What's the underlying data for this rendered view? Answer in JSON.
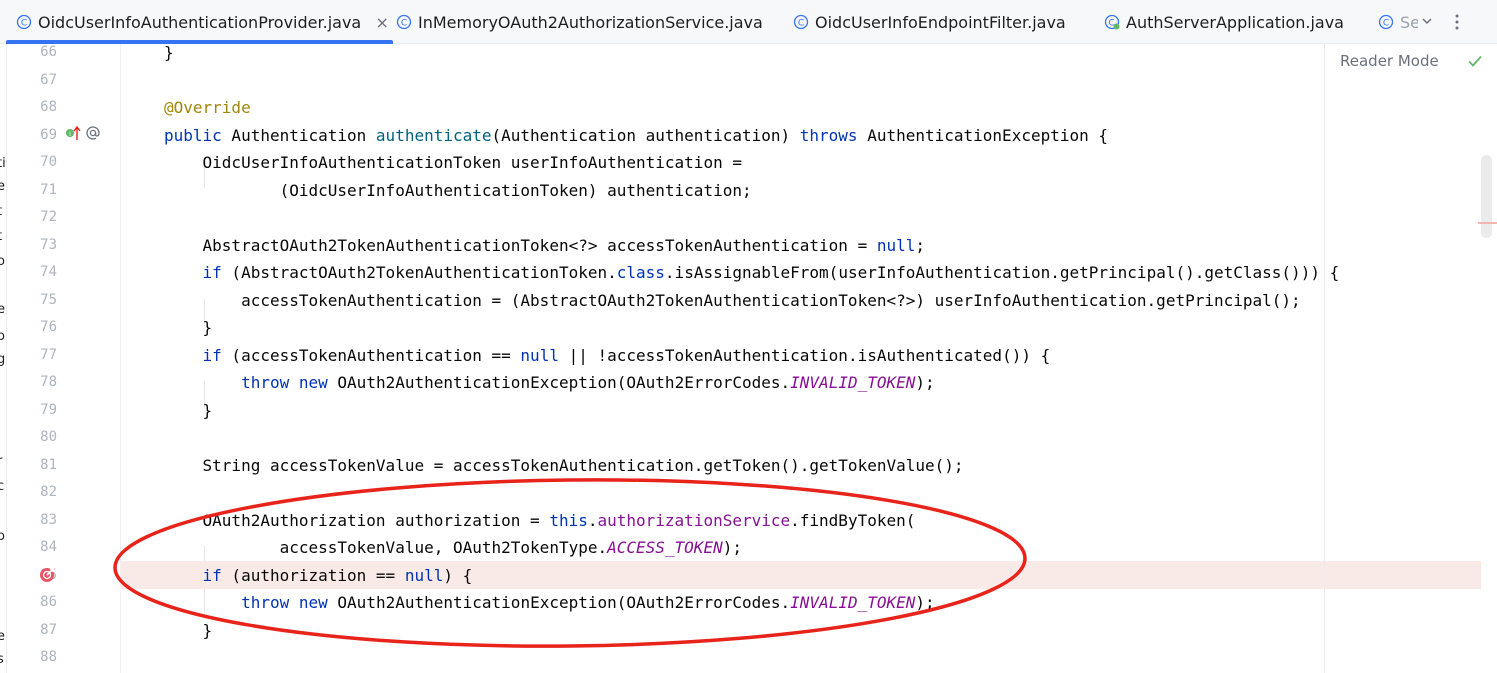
{
  "tabs": [
    {
      "label": "OidcUserInfoAuthenticationProvider.java",
      "icon": "class-icon",
      "active": true,
      "close": "×"
    },
    {
      "label": "InMemoryOAuth2AuthorizationService.java",
      "icon": "class-icon"
    },
    {
      "label": "OidcUserInfoEndpointFilter.java",
      "icon": "class-icon"
    },
    {
      "label": "AuthServerApplication.java",
      "icon": "spring-class-icon"
    },
    {
      "label": "Se",
      "icon": "class-icon"
    }
  ],
  "tab_overflow": {
    "icon": "chevron-down-icon",
    "more_icon": "more-vertical-icon"
  },
  "editor": {
    "reader_mode": "Reader Mode",
    "status_icon": "check-icon",
    "line_numbers": [
      "66",
      "67",
      "68",
      "69",
      "70",
      "71",
      "72",
      "73",
      "74",
      "75",
      "76",
      "77",
      "78",
      "79",
      "80",
      "81",
      "82",
      "83",
      "84",
      "85",
      "86",
      "87",
      "88"
    ],
    "gutter_icons": {
      "line69": [
        "implement-icon",
        "at-sign-icon"
      ],
      "line85": "breakpoint-icon"
    },
    "highlighted_line": 85
  },
  "code_lines": [
    {
      "ln": "66",
      "text": "}"
    },
    {
      "ln": "67",
      "text": ""
    },
    {
      "ln": "68",
      "text": "@Override"
    },
    {
      "ln": "69",
      "text": "public Authentication authenticate(Authentication authentication) throws AuthenticationException {"
    },
    {
      "ln": "70",
      "text": "    OidcUserInfoAuthenticationToken userInfoAuthentication ="
    },
    {
      "ln": "71",
      "text": "            (OidcUserInfoAuthenticationToken) authentication;"
    },
    {
      "ln": "72",
      "text": ""
    },
    {
      "ln": "73",
      "text": "    AbstractOAuth2TokenAuthenticationToken<?> accessTokenAuthentication = null;"
    },
    {
      "ln": "74",
      "text": "    if (AbstractOAuth2TokenAuthenticationToken.class.isAssignableFrom(userInfoAuthentication.getPrincipal().getClass())) {"
    },
    {
      "ln": "75",
      "text": "        accessTokenAuthentication = (AbstractOAuth2TokenAuthenticationToken<?>) userInfoAuthentication.getPrincipal();"
    },
    {
      "ln": "76",
      "text": "    }"
    },
    {
      "ln": "77",
      "text": "    if (accessTokenAuthentication == null || !accessTokenAuthentication.isAuthenticated()) {"
    },
    {
      "ln": "78",
      "text": "        throw new OAuth2AuthenticationException(OAuth2ErrorCodes.INVALID_TOKEN);"
    },
    {
      "ln": "79",
      "text": "    }"
    },
    {
      "ln": "80",
      "text": ""
    },
    {
      "ln": "81",
      "text": "    String accessTokenValue = accessTokenAuthentication.getToken().getTokenValue();"
    },
    {
      "ln": "82",
      "text": ""
    },
    {
      "ln": "83",
      "text": "    OAuth2Authorization authorization = this.authorizationService.findByToken("
    },
    {
      "ln": "84",
      "text": "            accessTokenValue, OAuth2TokenType.ACCESS_TOKEN);"
    },
    {
      "ln": "85",
      "text": "    if (authorization == null) {"
    },
    {
      "ln": "86",
      "text": "        throw new OAuth2AuthenticationException(OAuth2ErrorCodes.INVALID_TOKEN);"
    },
    {
      "ln": "87",
      "text": "    }"
    },
    {
      "ln": "88",
      "text": ""
    }
  ],
  "colors": {
    "keyword": "#0033b3",
    "annotation": "#9e880d",
    "method": "#00627a",
    "field": "#871094",
    "highlight_line": "#faeae7",
    "tab_underline": "#3574f0",
    "ellipse": "#e8231a"
  }
}
